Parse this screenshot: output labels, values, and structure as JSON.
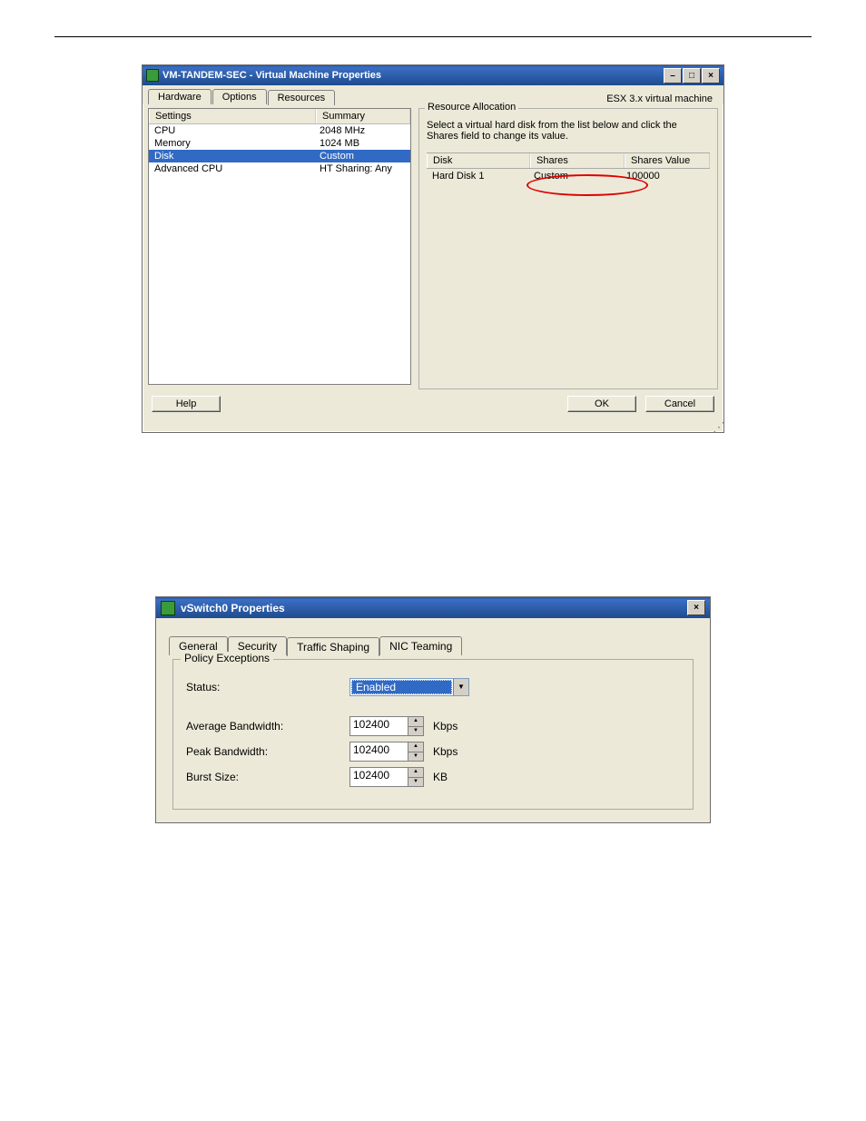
{
  "window1": {
    "title": "VM-TANDEM-SEC - Virtual Machine Properties",
    "tabs": [
      "Hardware",
      "Options",
      "Resources"
    ],
    "active_tab": 2,
    "esx_label": "ESX 3.x virtual machine",
    "left": {
      "headers": [
        "Settings",
        "Summary"
      ],
      "rows": [
        {
          "setting": "CPU",
          "summary": "2048 MHz"
        },
        {
          "setting": "Memory",
          "summary": "1024 MB"
        },
        {
          "setting": "Disk",
          "summary": "Custom"
        },
        {
          "setting": "Advanced CPU",
          "summary": "HT Sharing: Any"
        }
      ],
      "selected": 2
    },
    "right": {
      "groupbox": "Resource Allocation",
      "help": "Select a virtual hard disk from the list below and click the Shares field to change its value.",
      "headers": [
        "Disk",
        "Shares",
        "Shares Value"
      ],
      "row": {
        "disk": "Hard Disk 1",
        "shares": "Custom",
        "value": "100000"
      }
    },
    "buttons": {
      "help": "Help",
      "ok": "OK",
      "cancel": "Cancel"
    }
  },
  "window2": {
    "title": "vSwitch0 Properties",
    "tabs": [
      "General",
      "Security",
      "Traffic Shaping",
      "NIC Teaming"
    ],
    "active_tab": 2,
    "groupbox": "Policy Exceptions",
    "fields": {
      "status_label": "Status:",
      "status_value": "Enabled",
      "avg_label": "Average Bandwidth:",
      "avg_value": "102400",
      "avg_unit": "Kbps",
      "peak_label": "Peak Bandwidth:",
      "peak_value": "102400",
      "peak_unit": "Kbps",
      "burst_label": "Burst Size:",
      "burst_value": "102400",
      "burst_unit": "KB"
    }
  }
}
